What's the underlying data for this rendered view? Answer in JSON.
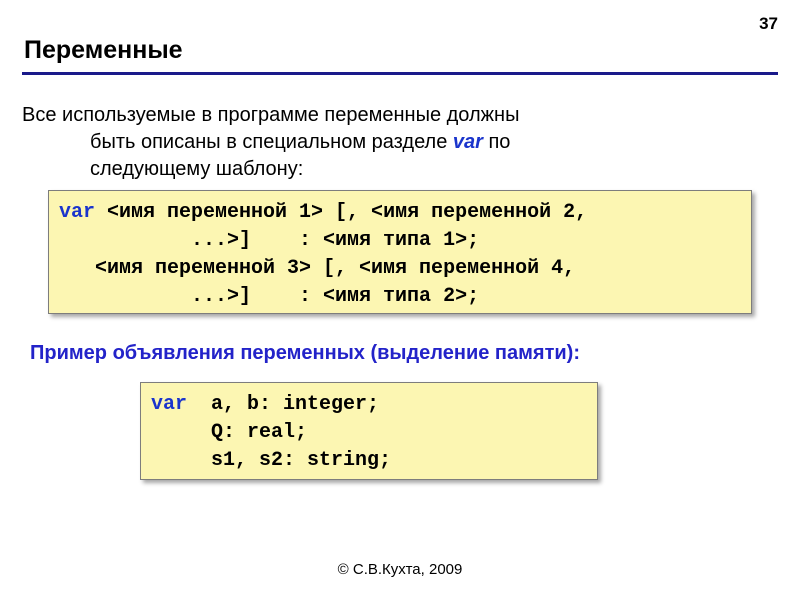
{
  "page_number": "37",
  "title": "Переменные",
  "intro": {
    "line1": "Все используемые в программе переменные должны",
    "line2_pre": "быть описаны в специальном разделе ",
    "var_kw": "var",
    "line2_post": " по",
    "line3": "следующему шаблону:"
  },
  "template": {
    "var": "var",
    "l1": " <имя переменной 1> [, <имя переменной 2,",
    "l2": "           ...>]    : <имя типа 1>;",
    "l3": "   <имя переменной 3> [, <имя переменной 4,",
    "l4": "           ...>]    : <имя типа 2>;"
  },
  "subtitle": "Пример объявления переменных (выделение памяти):",
  "example": {
    "var": "var",
    "l1_rest": "  a, b: integer;",
    "l2": "     Q: real;",
    "l3": "     s1, s2: string;"
  },
  "footer": "© С.В.Кухта, 2009"
}
